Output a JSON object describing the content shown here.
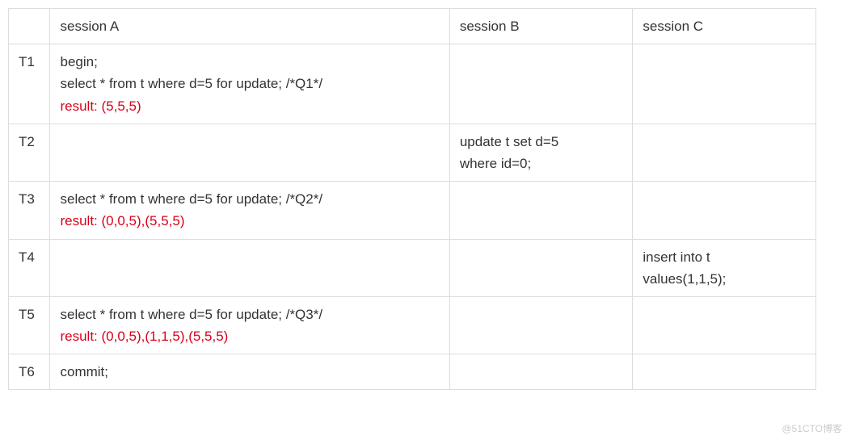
{
  "headers": {
    "time": "",
    "sessionA": "session A",
    "sessionB": "session B",
    "sessionC": "session C"
  },
  "rows": [
    {
      "time": "T1",
      "a_line1": "begin;",
      "a_line2": "select * from t where d=5 for update; /*Q1*/",
      "a_result": "result: (5,5,5)",
      "b": "",
      "c": ""
    },
    {
      "time": "T2",
      "a_line1": "",
      "a_line2": "",
      "a_result": "",
      "b_line1": "update t set d=5",
      "b_line2": "where id=0;",
      "c": ""
    },
    {
      "time": "T3",
      "a_line1": "select * from t where d=5 for update; /*Q2*/",
      "a_result": "result: (0,0,5),(5,5,5)",
      "b": "",
      "c": ""
    },
    {
      "time": "T4",
      "a_line1": "",
      "a_result": "",
      "b": "",
      "c_line1": "insert into t",
      "c_line2": "values(1,1,5);"
    },
    {
      "time": "T5",
      "a_line1": "select * from t where d=5 for update; /*Q3*/",
      "a_result": "result: (0,0,5),(1,1,5),(5,5,5)",
      "b": "",
      "c": ""
    },
    {
      "time": "T6",
      "a_line1": "commit;",
      "a_result": "",
      "b": "",
      "c": ""
    }
  ],
  "watermark": "@51CTO博客"
}
